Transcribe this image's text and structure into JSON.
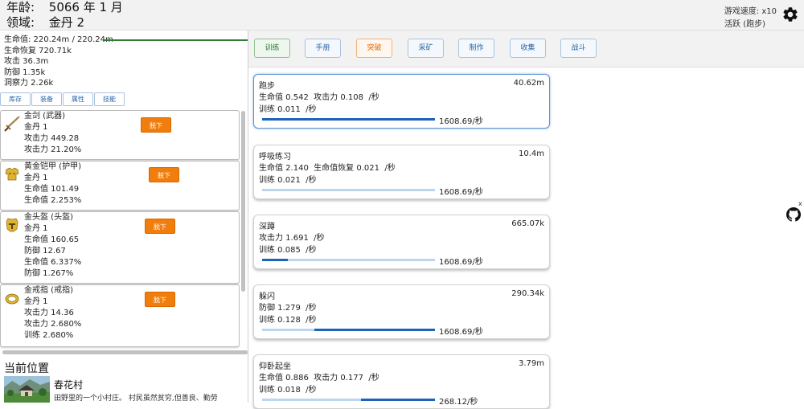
{
  "header": {
    "age_label": "年龄:",
    "age_value": "5066 年 1 月",
    "realm_label": "领域:",
    "realm_value": "金丹 2",
    "speed": "游戏速度: x10",
    "activity": "活跃 (跑步)"
  },
  "stats": {
    "hp": "生命值: 220.24m / 220.24m",
    "regen": "生命恢复 720.71k",
    "attack": "攻击 36.3m",
    "defense": "防御 1.35k",
    "insight": "洞察力 2.26k"
  },
  "left_tabs": [
    "库存",
    "装备",
    "属性",
    "技能"
  ],
  "equipment": [
    {
      "name": "金剑 (武器)",
      "lines": [
        "金丹 1",
        "攻击力 449.28",
        "攻击力 21.20%"
      ],
      "button": "脱下",
      "icon": "sword-icon"
    },
    {
      "name": "黄金铠甲 (护甲)",
      "lines": [
        "金丹 1",
        "生命值 101.49",
        "生命值 2.253%"
      ],
      "button": "脱下",
      "icon": "armor-icon"
    },
    {
      "name": "金头盔 (头盔)",
      "lines": [
        "金丹 1",
        "生命值 160.65",
        "防御 12.67",
        "生命值 6.337%",
        "防御 1.267%"
      ],
      "button": "脱下",
      "icon": "helmet-icon"
    },
    {
      "name": "金戒指 (戒指)",
      "lines": [
        "金丹 1",
        "攻击力 14.36",
        "攻击力 2.680%",
        "训练 2.680%"
      ],
      "button": "脱下",
      "icon": "ring-icon"
    }
  ],
  "location": {
    "title": "当前位置",
    "name": "春花村",
    "desc": "田野里的一个小村庄。 村民虽然贫穷,但善良、勤劳"
  },
  "menu": [
    {
      "label": "训练",
      "state": "active"
    },
    {
      "label": "手册",
      "state": "normal"
    },
    {
      "label": "突破",
      "state": "warn"
    },
    {
      "label": "采矿",
      "state": "normal"
    },
    {
      "label": "制作",
      "state": "normal"
    },
    {
      "label": "收集",
      "state": "normal"
    },
    {
      "label": "战斗",
      "state": "normal"
    }
  ],
  "trainings": [
    {
      "name": "跑步",
      "value": "40.62m",
      "effect": "生命值 0.542  攻击力 0.108  /秒",
      "progress_text": "训练 0.011  /秒",
      "rate": "1608.69/秒",
      "fill_start": 0.0,
      "fill_end": 1.0,
      "selected": true
    },
    {
      "name": "呼吸练习",
      "value": "10.4m",
      "effect": "生命值 2.140  生命值恢复 0.021  /秒",
      "progress_text": "训练 0.021  /秒",
      "rate": "1608.69/秒",
      "fill_start": 0.0,
      "fill_end": 0.0,
      "selected": false
    },
    {
      "name": "深蹲",
      "value": "665.07k",
      "effect": "攻击力 1.691  /秒",
      "progress_text": "训练 0.085  /秒",
      "rate": "1608.69/秒",
      "fill_start": 0.0,
      "fill_end": 0.15,
      "selected": false
    },
    {
      "name": "躲闪",
      "value": "290.34k",
      "effect": "防御 1.279  /秒",
      "progress_text": "训练 0.128  /秒",
      "rate": "1608.69/秒",
      "fill_start": 0.3,
      "fill_end": 1.0,
      "selected": false
    },
    {
      "name": "仰卧起坐",
      "value": "3.79m",
      "effect": "生命值 0.886  攻击力 0.177  /秒",
      "progress_text": "训练 0.018  /秒",
      "rate": "268.12/秒",
      "fill_start": 0.57,
      "fill_end": 1.0,
      "selected": false
    }
  ],
  "floating": {
    "close": "x",
    "icon": "github-icon"
  }
}
